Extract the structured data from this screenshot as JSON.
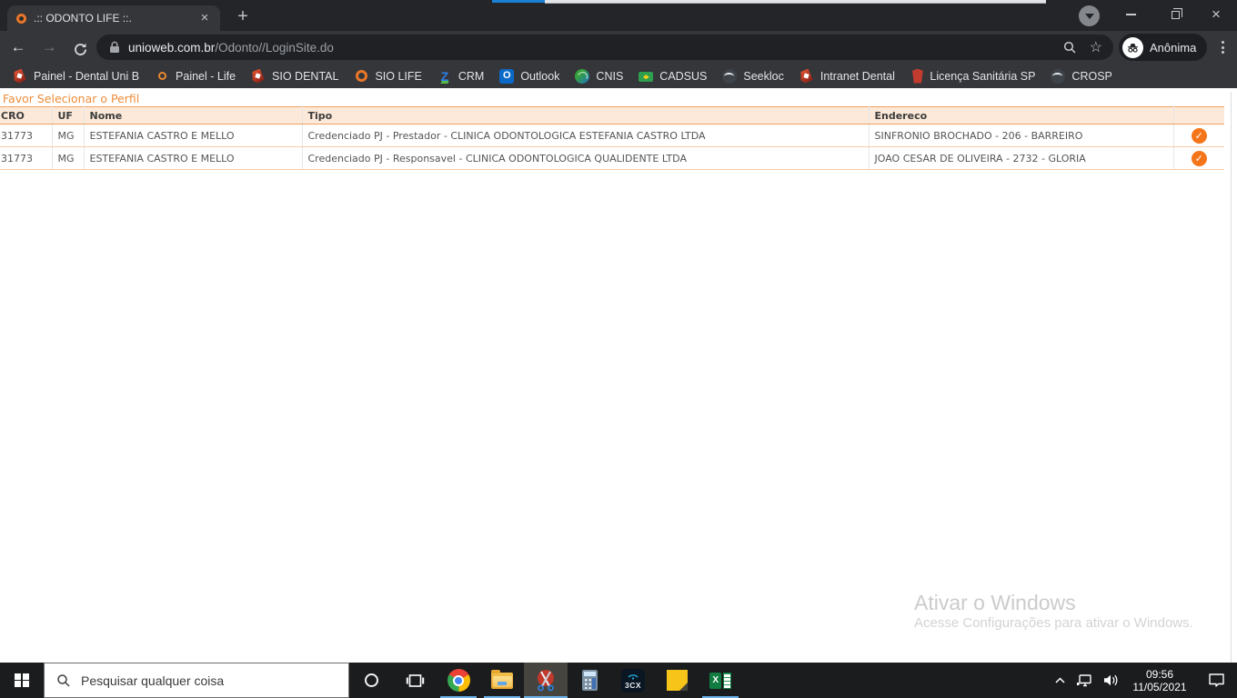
{
  "browser": {
    "tab_title": ".:: ODONTO LIFE ::.",
    "tab_close_glyph": "×",
    "new_tab_glyph": "+",
    "back_glyph": "←",
    "forward_glyph": "→",
    "url_domain": "unioweb.com.br",
    "url_path": "/Odonto//LoginSite.do",
    "star_glyph": "☆",
    "profile_chip_label": "Anônima",
    "close_window_glyph": "×",
    "bookmarks": [
      {
        "label": "Painel - Dental Uni B",
        "icon": "dental-ribbon-icon"
      },
      {
        "label": "Painel - Life",
        "icon": "orange-ring-small-icon"
      },
      {
        "label": "SIO DENTAL",
        "icon": "dental-ribbon-icon"
      },
      {
        "label": "SIO LIFE",
        "icon": "orange-ring-icon"
      },
      {
        "label": "CRM",
        "icon": "crm-z-icon",
        "glyph": "Z"
      },
      {
        "label": "Outlook",
        "icon": "outlook-icon",
        "glyph": "O"
      },
      {
        "label": "CNIS",
        "icon": "globe-green-blue-icon"
      },
      {
        "label": "CADSUS",
        "icon": "green-card-flag-icon"
      },
      {
        "label": "Seekloc",
        "icon": "dark-globe-icon"
      },
      {
        "label": "Intranet Dental",
        "icon": "dental-ribbon-icon"
      },
      {
        "label": "Licença Sanitária SP",
        "icon": "red-emblem-icon"
      },
      {
        "label": "CROSP",
        "icon": "dark-globe-icon"
      }
    ]
  },
  "page": {
    "title": "Favor Selecionar o Perfil",
    "table": {
      "headers": {
        "cro": "CRO",
        "uf": "UF",
        "nome": "Nome",
        "tipo": "Tipo",
        "endereco": "Endereco"
      },
      "check_glyph": "✓",
      "rows": [
        {
          "cro": "31773",
          "uf": "MG",
          "nome": "ESTEFANIA CASTRO E MELLO",
          "tipo": "Credenciado PJ - Prestador - CLINICA ODONTOLOGICA ESTEFANIA CASTRO LTDA",
          "endereco": "SINFRONIO BROCHADO - 206 - BARREIRO"
        },
        {
          "cro": "31773",
          "uf": "MG",
          "nome": "ESTEFANIA CASTRO E MELLO",
          "tipo": "Credenciado PJ - Responsavel - CLINICA ODONTOLOGICA QUALIDENTE LTDA",
          "endereco": "JOAO CESAR DE OLIVEIRA - 2732 - GLORIA"
        }
      ]
    },
    "colors": {
      "accent_orange": "#EE8C3A",
      "header_bg": "#FCE9D9",
      "check_orange": "#F5761A"
    }
  },
  "watermark": {
    "line1": "Ativar o Windows",
    "line2": "Acesse Configurações para ativar o Windows."
  },
  "taskbar": {
    "search_placeholder": "Pesquisar qualquer coisa",
    "apps": [
      {
        "name": "chrome",
        "running": true
      },
      {
        "name": "file-explorer",
        "running": true
      },
      {
        "name": "snipping-tool",
        "running": true,
        "active": true
      },
      {
        "name": "calculator",
        "running": false
      },
      {
        "name": "3cx",
        "running": false,
        "glyph": "3CX"
      },
      {
        "name": "sticky-notes",
        "running": false
      },
      {
        "name": "excel",
        "running": true,
        "glyph": "X"
      }
    ],
    "clock_time": "09:56",
    "clock_date": "11/05/2021"
  }
}
